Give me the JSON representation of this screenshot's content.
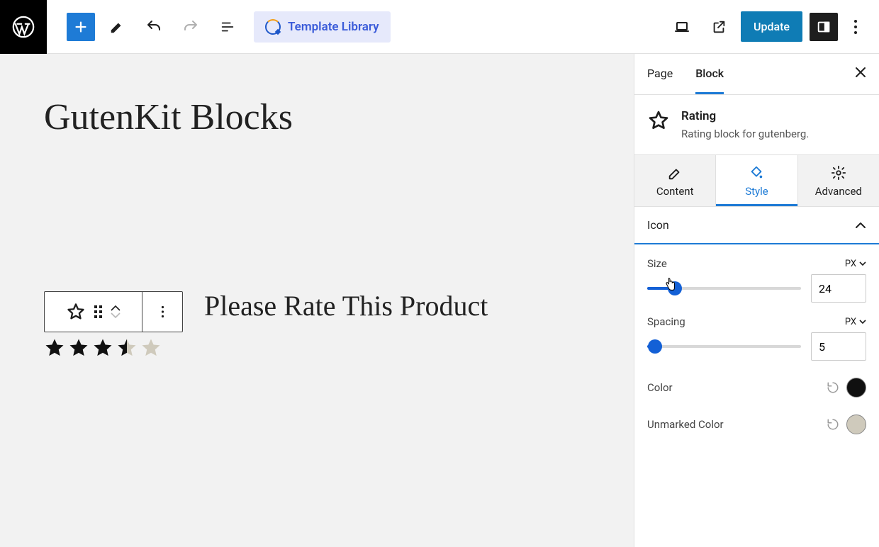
{
  "toolbar": {
    "template_library": "Template Library",
    "update": "Update"
  },
  "sidebar": {
    "tabs": {
      "page": "Page",
      "block": "Block"
    },
    "block": {
      "name": "Rating",
      "desc": "Rating block for gutenberg."
    },
    "sub_tabs": {
      "content": "Content",
      "style": "Style",
      "advanced": "Advanced"
    },
    "section": "Icon",
    "size": {
      "label": "Size",
      "unit": "PX",
      "value": "24",
      "pct": 18
    },
    "spacing": {
      "label": "Spacing",
      "unit": "PX",
      "value": "5",
      "pct": 5
    },
    "color": {
      "label": "Color",
      "value": "#101010"
    },
    "unmarked": {
      "label": "Unmarked Color",
      "value": "#cfcabc"
    }
  },
  "canvas": {
    "page_title": "GutenKit Blocks",
    "rate_label": "Please Rate This Product",
    "rating": 3.5
  }
}
